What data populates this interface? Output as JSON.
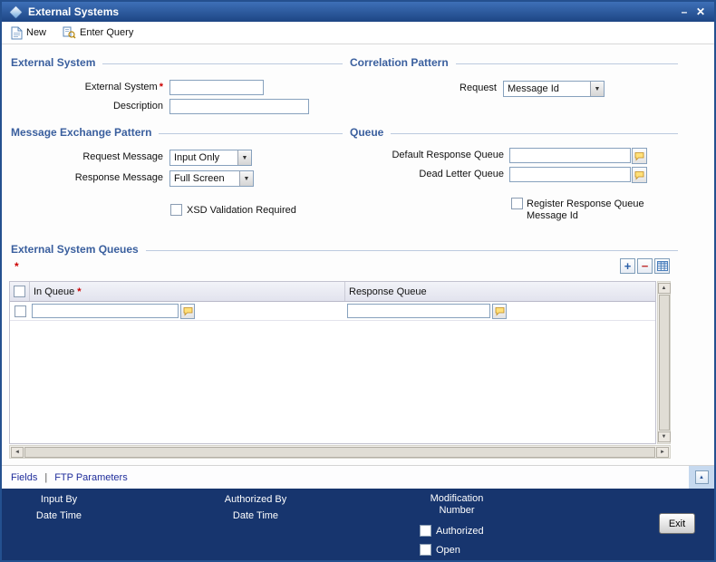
{
  "window": {
    "title": "External Systems"
  },
  "icons": {
    "minimize": "–",
    "close": "✕",
    "dropdown_arrow": "▼",
    "up_arrow": "▲",
    "down_arrow": "▼",
    "left_arrow": "◄",
    "right_arrow": "►",
    "add": "+",
    "remove": "−"
  },
  "toolbar": {
    "new_label": "New",
    "enter_query_label": "Enter Query"
  },
  "external_system_section": {
    "title": "External System",
    "external_system_label": "External System",
    "required_marker": "*",
    "description_label": "Description"
  },
  "correlation_section": {
    "title": "Correlation Pattern",
    "request_label": "Request",
    "request_value": "Message Id"
  },
  "message_exchange_section": {
    "title": "Message Exchange Pattern",
    "request_message_label": "Request Message",
    "request_message_value": "Input Only",
    "response_message_label": "Response Message",
    "response_message_value": "Full Screen",
    "xsd_label": "XSD Validation Required"
  },
  "queue_section": {
    "title": "Queue",
    "default_response_queue_label": "Default Response Queue",
    "dead_letter_queue_label": "Dead Letter Queue",
    "register_label": "Register Response Queue Message Id"
  },
  "queues_grid": {
    "title": "External System Queues",
    "required_marker": "*",
    "columns": {
      "in_queue": "In Queue",
      "in_queue_required": "*",
      "response_queue": "Response Queue"
    }
  },
  "links": {
    "fields": "Fields",
    "separator": "|",
    "ftp_parameters": "FTP Parameters"
  },
  "footer": {
    "input_by": "Input By",
    "date_time_left": "Date Time",
    "authorized_by": "Authorized By",
    "date_time_middle": "Date Time",
    "modification_number": "Modification Number",
    "authorized_label": "Authorized",
    "open_label": "Open",
    "exit_label": "Exit"
  },
  "colors": {
    "titlebar_gradient_top": "#3e70b8",
    "titlebar_gradient_bottom": "#1d4584",
    "footer_navy": "#17356e",
    "section_heading_blue": "#3a5f9e",
    "required_red": "#cc0000",
    "link_navy": "#1f2d9b",
    "lov_bubble_yellow": "#ffe07a"
  }
}
